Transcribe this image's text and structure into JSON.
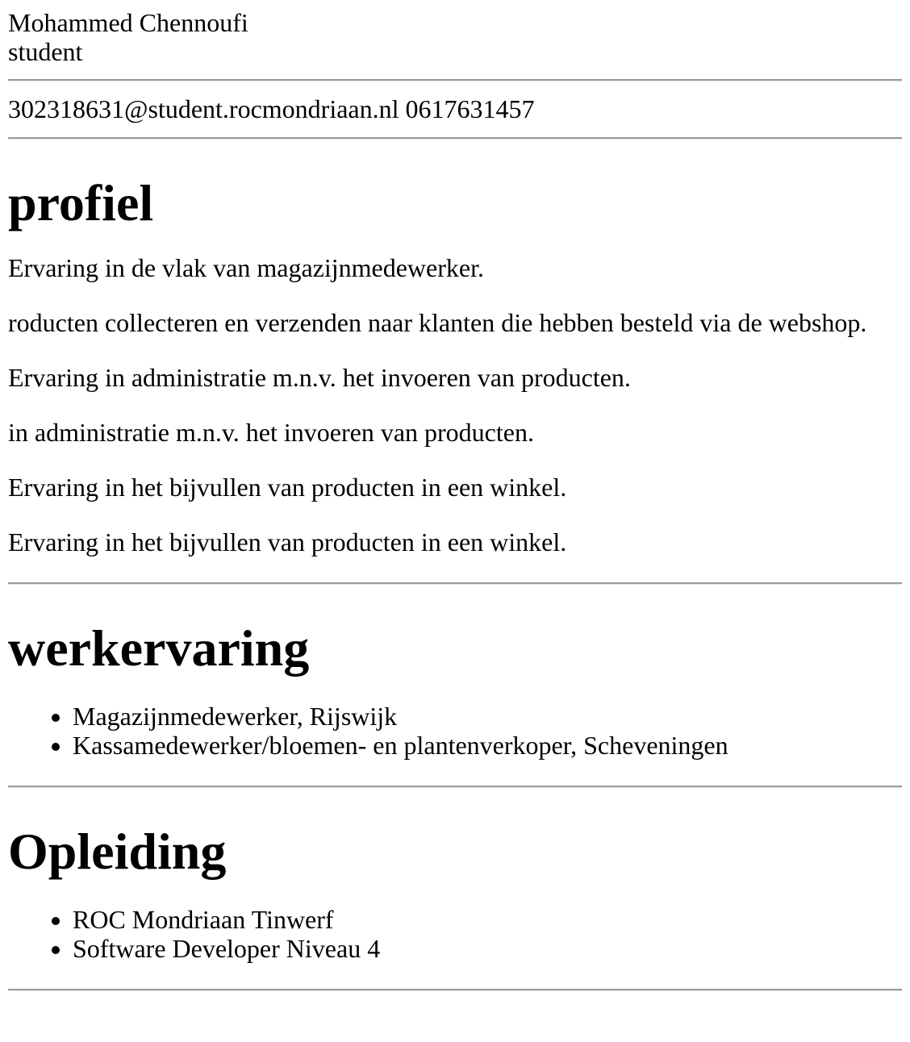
{
  "header": {
    "name": "Mohammed Chennoufi",
    "role": "student"
  },
  "contact": {
    "line": "302318631@student.rocmondriaan.nl 0617631457"
  },
  "profile": {
    "heading": "profiel",
    "paragraphs": [
      "Ervaring in de vlak van magazijnmedewerker.",
      "roducten collecteren en verzenden naar klanten die hebben besteld via de webshop.",
      "Ervaring in administratie m.n.v. het invoeren van producten.",
      "in administratie m.n.v. het invoeren van producten.",
      "Ervaring in het bijvullen van producten in een winkel.",
      "Ervaring in het bijvullen van producten in een winkel."
    ]
  },
  "work": {
    "heading": "werkervaring",
    "items": [
      "Magazijnmedewerker, Rijswijk",
      "Kassamedewerker/bloemen- en plantenverkoper, Scheveningen"
    ]
  },
  "education": {
    "heading": "Opleiding",
    "items": [
      "ROC Mondriaan Tinwerf",
      "Software Developer Niveau 4"
    ]
  }
}
